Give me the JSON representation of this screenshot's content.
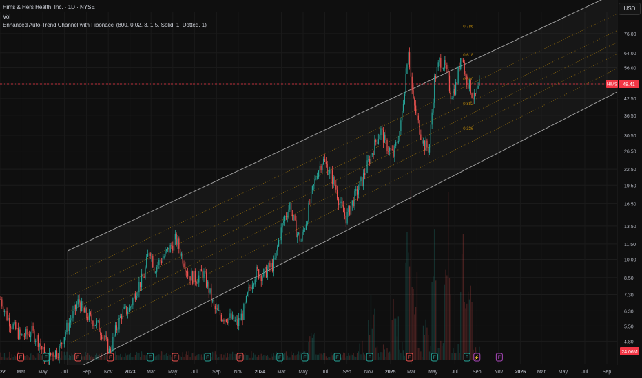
{
  "header": {
    "symbol_line": "Hims & Hers Health, Inc. · 1D · NYSE",
    "vol_label": "Vol",
    "indicator_line": "Enhanced Auto-Trend Channel with Fibonacci (800, 0.02, 3, 1.5, Solid, 1, Dotted, 1)"
  },
  "currency": "USD",
  "colors": {
    "background": "#0f0f0f",
    "up": "#26a69a",
    "down": "#ef5350",
    "channel": "#9e9e9e",
    "fib": "#b8860b",
    "price_line": "#f23645",
    "earnings": "#ef5350",
    "earnings_green": "#26a69a",
    "future_event": "#ab47bc"
  },
  "chart_data": {
    "type": "candlestick",
    "title": "Hims & Hers Health, Inc. · 1D · NYSE",
    "y_scale": "log",
    "y_ticks": [
      76.0,
      64.0,
      56.0,
      48.41,
      42.5,
      36.5,
      30.5,
      26.5,
      22.5,
      19.5,
      16.5,
      13.5,
      11.5,
      10.0,
      8.5,
      7.3,
      6.3,
      5.5,
      4.8
    ],
    "ylim": [
      3.9,
      92
    ],
    "x_ticks": [
      "2022",
      "Mar",
      "May",
      "Jul",
      "Sep",
      "Nov",
      "2023",
      "Mar",
      "May",
      "Jul",
      "Sep",
      "Nov",
      "2024",
      "Mar",
      "May",
      "Jul",
      "Sep",
      "Nov",
      "2025",
      "Mar",
      "May",
      "Jul",
      "Sep",
      "Nov",
      "2026",
      "Mar",
      "May",
      "Jul",
      "Sep"
    ],
    "xlim": [
      "2022-01-01",
      "2026-09-30"
    ],
    "last_price": {
      "symbol": "HIMS",
      "value": "48.41"
    },
    "volume_tag": "24.06M",
    "fib_labels": [
      {
        "label": "0.786",
        "date": "2025-07-01",
        "price": 80
      },
      {
        "label": "0.618",
        "date": "2025-07-01",
        "price": 62
      },
      {
        "label": "0.500",
        "date": "2025-07-01",
        "price": 50
      },
      {
        "label": "0.382",
        "date": "2025-07-01",
        "price": 40
      },
      {
        "label": "0.236",
        "date": "2025-07-01",
        "price": 32
      }
    ],
    "channel": {
      "start_date": "2022-07-10",
      "end_date": "2026-09-30",
      "upper_start": 10.8,
      "upper_end": 110,
      "lower_start": 3.6,
      "lower_end": 45
    },
    "price_path": [
      [
        "2022-01-03",
        7.0
      ],
      [
        "2022-01-20",
        6.0
      ],
      [
        "2022-02-10",
        5.4
      ],
      [
        "2022-03-01",
        5.0
      ],
      [
        "2022-04-01",
        5.2
      ],
      [
        "2022-04-20",
        4.8
      ],
      [
        "2022-05-12",
        4.0
      ],
      [
        "2022-05-25",
        4.3
      ],
      [
        "2022-06-15",
        4.4
      ],
      [
        "2022-07-05",
        5.3
      ],
      [
        "2022-07-25",
        6.1
      ],
      [
        "2022-08-10",
        6.9
      ],
      [
        "2022-08-25",
        6.2
      ],
      [
        "2022-09-10",
        5.9
      ],
      [
        "2022-09-30",
        5.6
      ],
      [
        "2022-10-20",
        5.0
      ],
      [
        "2022-11-05",
        4.3
      ],
      [
        "2022-11-20",
        5.2
      ],
      [
        "2022-12-10",
        6.2
      ],
      [
        "2022-12-30",
        6.4
      ],
      [
        "2023-01-20",
        7.7
      ],
      [
        "2023-02-10",
        8.7
      ],
      [
        "2023-02-25",
        11.2
      ],
      [
        "2023-03-10",
        9.2
      ],
      [
        "2023-03-30",
        10.0
      ],
      [
        "2023-04-20",
        10.9
      ],
      [
        "2023-05-10",
        12.0
      ],
      [
        "2023-05-25",
        10.5
      ],
      [
        "2023-06-15",
        8.7
      ],
      [
        "2023-07-05",
        8.4
      ],
      [
        "2023-07-25",
        8.9
      ],
      [
        "2023-08-10",
        7.7
      ],
      [
        "2023-08-25",
        6.4
      ],
      [
        "2023-09-15",
        6.0
      ],
      [
        "2023-10-10",
        5.9
      ],
      [
        "2023-10-30",
        5.6
      ],
      [
        "2023-11-15",
        6.2
      ],
      [
        "2023-12-05",
        7.9
      ],
      [
        "2023-12-20",
        8.9
      ],
      [
        "2024-01-10",
        8.7
      ],
      [
        "2024-01-25",
        9.2
      ],
      [
        "2024-02-10",
        9.6
      ],
      [
        "2024-02-25",
        12.3
      ],
      [
        "2024-03-10",
        14.5
      ],
      [
        "2024-03-25",
        16.3
      ],
      [
        "2024-04-10",
        13.1
      ],
      [
        "2024-04-25",
        11.8
      ],
      [
        "2024-05-10",
        14.2
      ],
      [
        "2024-05-25",
        18.0
      ],
      [
        "2024-06-10",
        22.0
      ],
      [
        "2024-06-25",
        24.5
      ],
      [
        "2024-07-15",
        21.8
      ],
      [
        "2024-07-30",
        19.5
      ],
      [
        "2024-08-15",
        16.0
      ],
      [
        "2024-08-30",
        14.5
      ],
      [
        "2024-09-15",
        16.5
      ],
      [
        "2024-09-30",
        18.4
      ],
      [
        "2024-10-15",
        20.5
      ],
      [
        "2024-11-05",
        25.0
      ],
      [
        "2024-11-20",
        28.5
      ],
      [
        "2024-12-05",
        32.0
      ],
      [
        "2024-12-20",
        28.0
      ],
      [
        "2025-01-10",
        25.5
      ],
      [
        "2025-01-30",
        33.0
      ],
      [
        "2025-02-12",
        50.0
      ],
      [
        "2025-02-20",
        68.0
      ],
      [
        "2025-03-05",
        42.0
      ],
      [
        "2025-03-20",
        34.0
      ],
      [
        "2025-04-05",
        28.0
      ],
      [
        "2025-04-20",
        27.0
      ],
      [
        "2025-05-05",
        50.0
      ],
      [
        "2025-05-20",
        60.0
      ],
      [
        "2025-06-05",
        56.0
      ],
      [
        "2025-06-20",
        44.0
      ],
      [
        "2025-07-05",
        48.0
      ],
      [
        "2025-07-20",
        65.0
      ],
      [
        "2025-07-30",
        52.0
      ],
      [
        "2025-08-10",
        48.0
      ],
      [
        "2025-08-25",
        42.0
      ],
      [
        "2025-09-10",
        48.41
      ]
    ],
    "volume_spikes": [
      [
        "2025-02-20",
        1.0
      ],
      [
        "2025-05-05",
        0.75
      ],
      [
        "2025-06-10",
        0.95
      ],
      [
        "2025-07-25",
        0.6
      ],
      [
        "2025-03-10",
        0.45
      ],
      [
        "2024-11-10",
        0.35
      ],
      [
        "2024-05-25",
        0.3
      ],
      [
        "2025-08-10",
        0.55
      ],
      [
        "2025-01-15",
        0.3
      ],
      [
        "2025-04-10",
        0.35
      ]
    ],
    "events": [
      {
        "date": "2022-02-28",
        "kind": "E",
        "color": "red"
      },
      {
        "date": "2022-05-10",
        "kind": "E",
        "color": "green"
      },
      {
        "date": "2022-08-08",
        "kind": "E",
        "color": "red"
      },
      {
        "date": "2022-11-07",
        "kind": "E",
        "color": "red"
      },
      {
        "date": "2023-02-27",
        "kind": "E",
        "color": "green"
      },
      {
        "date": "2023-05-08",
        "kind": "E",
        "color": "red"
      },
      {
        "date": "2023-08-07",
        "kind": "E",
        "color": "green"
      },
      {
        "date": "2023-11-06",
        "kind": "E",
        "color": "red"
      },
      {
        "date": "2024-02-26",
        "kind": "E",
        "color": "green"
      },
      {
        "date": "2024-05-06",
        "kind": "E",
        "color": "green"
      },
      {
        "date": "2024-08-05",
        "kind": "E",
        "color": "green"
      },
      {
        "date": "2024-11-04",
        "kind": "E",
        "color": "green"
      },
      {
        "date": "2025-02-24",
        "kind": "E",
        "color": "red"
      },
      {
        "date": "2025-05-05",
        "kind": "E",
        "color": "green"
      },
      {
        "date": "2025-08-04",
        "kind": "E",
        "color": "green"
      },
      {
        "date": "2025-09-01",
        "kind": "⚡",
        "color": "purple"
      },
      {
        "date": "2025-11-03",
        "kind": "E",
        "color": "purple"
      }
    ]
  }
}
